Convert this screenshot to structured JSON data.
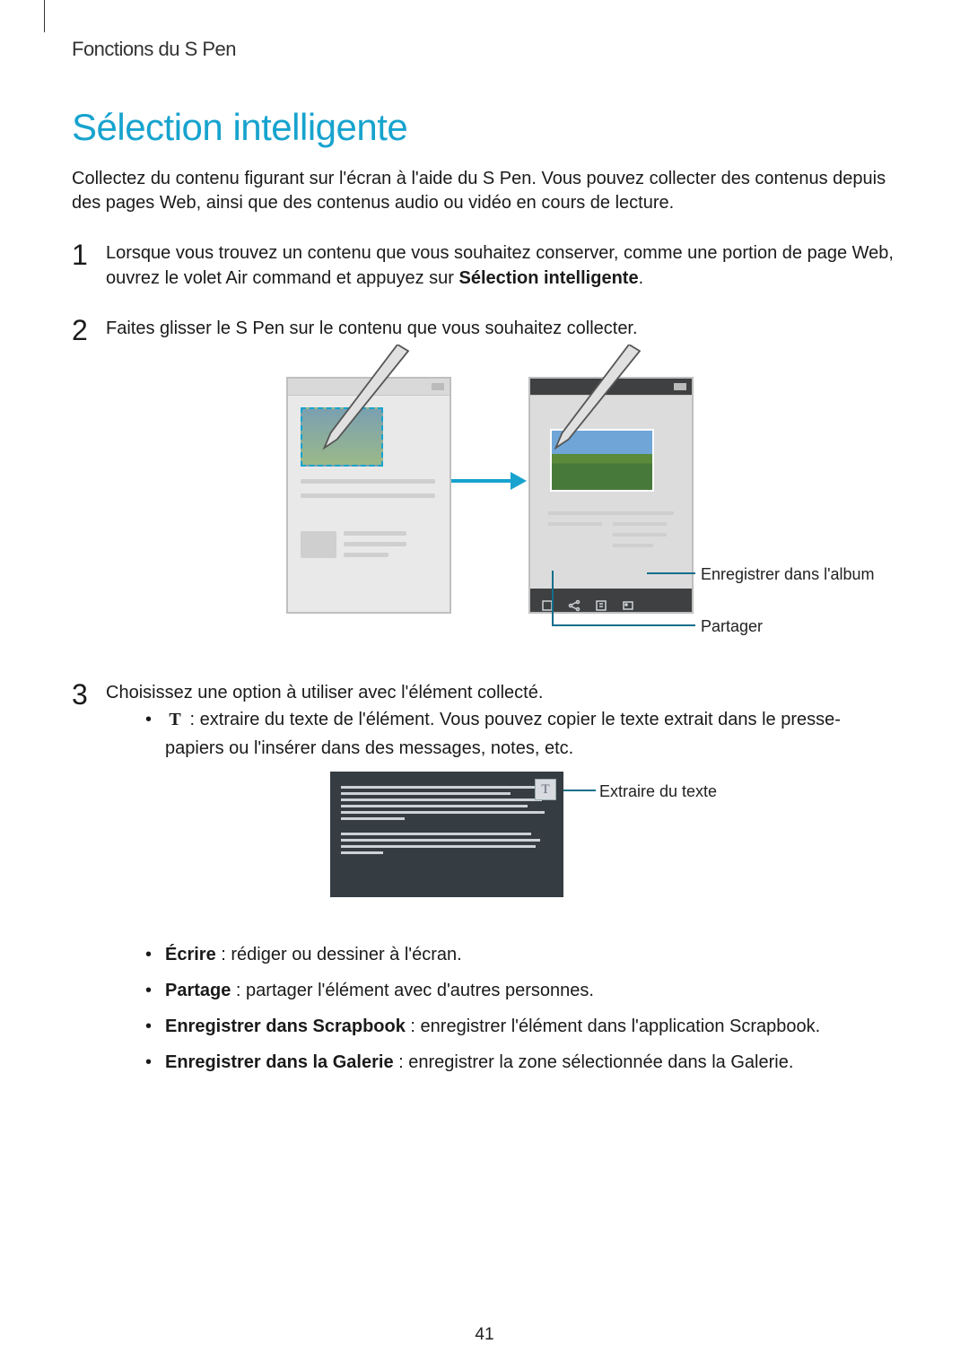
{
  "chapter": "Fonctions du S Pen",
  "title": "Sélection intelligente",
  "intro": "Collectez du contenu figurant sur l'écran à l'aide du S Pen. Vous pouvez collecter des contenus depuis des pages Web, ainsi que des contenus audio ou vidéo en cours de lecture.",
  "steps": {
    "s1": {
      "num": "1",
      "text_a": "Lorsque vous trouvez un contenu que vous souhaitez conserver, comme une portion de page Web, ouvrez le volet Air command et appuyez sur ",
      "text_b": "Sélection intelligente",
      "text_c": "."
    },
    "s2": {
      "num": "2",
      "text": "Faites glisser le S Pen sur le contenu que vous souhaitez collecter."
    },
    "s3": {
      "num": "3",
      "text": "Choisissez une option à utiliser avec l'élément collecté."
    }
  },
  "callouts": {
    "save": "Enregistrer dans l'album",
    "share": "Partager",
    "extract": "Extraire du texte"
  },
  "sub_bullets": {
    "textract": " : extraire du texte de l'élément. Vous pouvez copier le texte extrait dans le presse-papiers ou l'insérer dans des messages, notes, etc.",
    "write": {
      "label": "Écrire",
      "desc": " : rédiger ou dessiner à l'écran."
    },
    "sharing": {
      "label": "Partage",
      "desc": " : partager l'élément avec d'autres personnes."
    },
    "scrapbook": {
      "label": "Enregistrer dans Scrapbook",
      "desc": " : enregistrer l'élément dans l'application Scrapbook."
    },
    "gallery": {
      "label": "Enregistrer dans la Galerie",
      "desc": " : enregistrer la zone sélectionnée dans la Galerie."
    }
  },
  "icons": {
    "T": "T"
  },
  "page_number": "41"
}
